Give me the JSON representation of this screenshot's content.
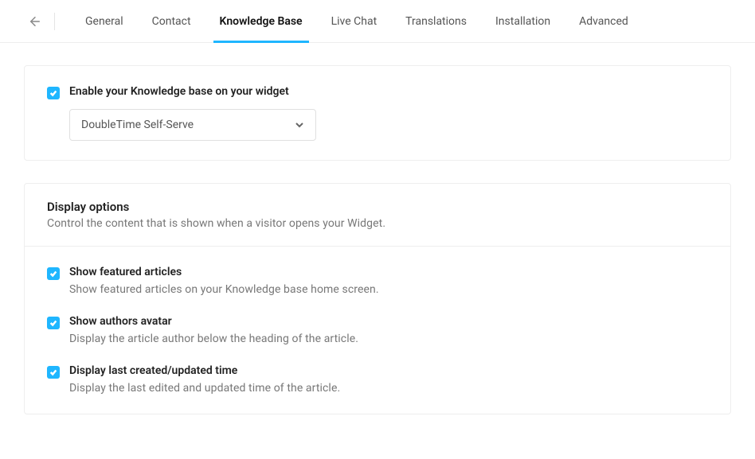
{
  "tabs": {
    "items": [
      {
        "label": "General"
      },
      {
        "label": "Contact"
      },
      {
        "label": "Knowledge Base"
      },
      {
        "label": "Live Chat"
      },
      {
        "label": "Translations"
      },
      {
        "label": "Installation"
      },
      {
        "label": "Advanced"
      }
    ],
    "activeIndex": 2
  },
  "enable": {
    "label": "Enable your Knowledge base on your widget",
    "selected": "DoubleTime Self-Serve"
  },
  "display": {
    "title": "Display options",
    "subtitle": "Control the content that is shown when a visitor opens your Widget.",
    "options": [
      {
        "title": "Show featured articles",
        "desc": "Show featured articles on your Knowledge base home screen."
      },
      {
        "title": "Show authors avatar",
        "desc": "Display the article author below the heading of the article."
      },
      {
        "title": "Display last created/updated time",
        "desc": "Display the last edited and updated time of the article."
      }
    ]
  }
}
